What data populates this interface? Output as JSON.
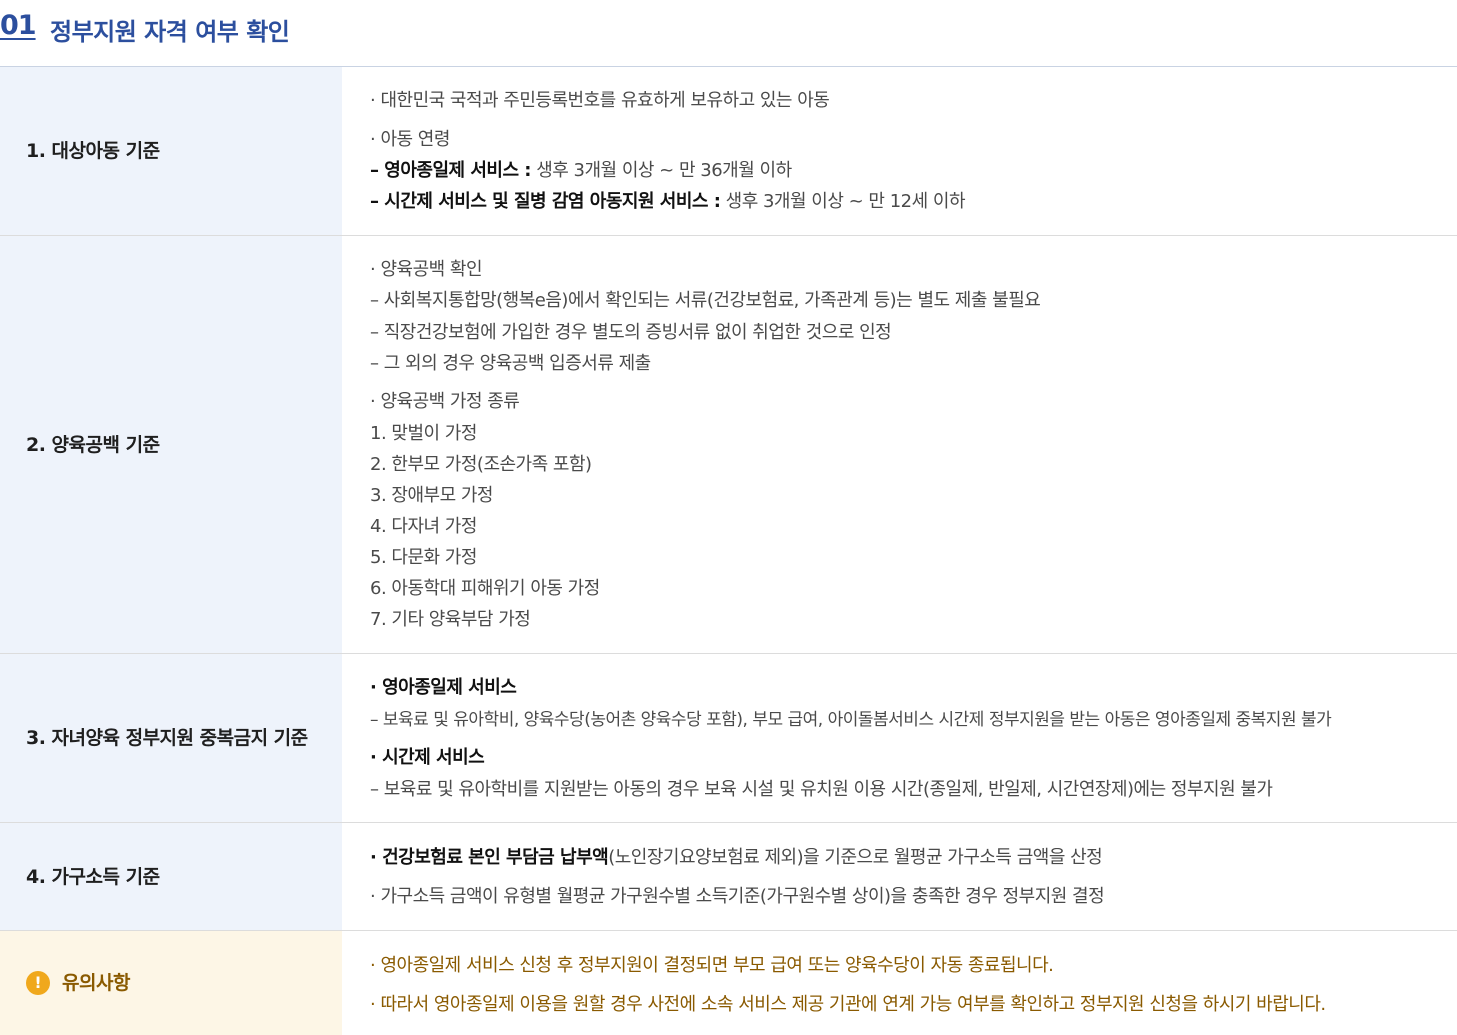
{
  "section": {
    "number": "01",
    "title": "정부지원 자격 여부 확인"
  },
  "rows": [
    {
      "head": "1. 대상아동 기준",
      "lines": [
        {
          "plain": "· 대한민국 국적과 주민등록번호를 유효하게 보유하고 있는 아동"
        },
        {
          "plain": "· 아동 연령"
        },
        {
          "bold": "– 영아종일제 서비스 :",
          "plain": " 생후 3개월 이상 ~ 만 36개월 이하"
        },
        {
          "bold": "– 시간제 서비스 및 질병 감염 아동지원 서비스 :",
          "plain": " 생후 3개월 이상 ~ 만 12세 이하"
        }
      ]
    },
    {
      "head": "2. 양육공백 기준",
      "lines": [
        {
          "plain": "· 양육공백 확인"
        },
        {
          "plain": "– 사회복지통합망(행복e음)에서 확인되는 서류(건강보험료, 가족관계 등)는 별도 제출 불필요"
        },
        {
          "plain": "– 직장건강보험에 가입한 경우 별도의 증빙서류 없이 취업한 것으로 인정"
        },
        {
          "plain": "– 그 외의 경우 양육공백 입증서류 제출"
        },
        {
          "plain": "· 양육공백 가정 종류"
        },
        {
          "plain": "1. 맞벌이 가정"
        },
        {
          "plain": "2. 한부모 가정(조손가족 포함)"
        },
        {
          "plain": "3. 장애부모 가정"
        },
        {
          "plain": "4. 다자녀 가정"
        },
        {
          "plain": "5. 다문화 가정"
        },
        {
          "plain": "6. 아동학대 피해위기 아동 가정"
        },
        {
          "plain": "7. 기타 양육부담 가정"
        }
      ]
    },
    {
      "head": "3. 자녀양육 정부지원 중복금지 기준",
      "lines": [
        {
          "bold": "· 영아종일제 서비스"
        },
        {
          "plain": "– 보육료 및 유아학비, 양육수당(농어촌 양육수당 포함), 부모 급여, 아이돌봄서비스 시간제 정부지원을 받는 아동은 영아종일제 중복지원 불가"
        },
        {
          "bold": "· 시간제 서비스"
        },
        {
          "plain": "– 보육료 및 유아학비를 지원받는 아동의 경우 보육 시설 및 유치원 이용 시간(종일제, 반일제, 시간연장제)에는 정부지원 불가"
        }
      ]
    },
    {
      "head": "4. 가구소득 기준",
      "lines": [
        {
          "bold": "· 건강보험료 본인 부담금 납부액",
          "plain": "(노인장기요양보험료 제외)을 기준으로 월평균 가구소득 금액을 산정"
        },
        {
          "plain": "· 가구소득 금액이 유형별 월평균 가구원수별 소득기준(가구원수별 상이)을 충족한 경우 정부지원 결정"
        }
      ]
    }
  ],
  "notice": {
    "icon": "!",
    "head": "유의사항",
    "lines": [
      {
        "plain": "· 영아종일제 서비스 신청 후 정부지원이 결정되면 부모 급여 또는 양육수당이 자동 종료됩니다."
      },
      {
        "plain": "· 따라서 영아종일제 이용을 원할 경우 사전에 소속 서비스 제공 기관에 연계 가능 여부를 확인하고 정부지원 신청을 하시기 바랍니다."
      }
    ]
  },
  "colors": {
    "accent": "#2c4f9e",
    "row_head_bg": "#eef3fb",
    "notice_bg": "#fdf6e6",
    "notice_text": "#8a5a00",
    "notice_icon": "#f0a81c"
  }
}
